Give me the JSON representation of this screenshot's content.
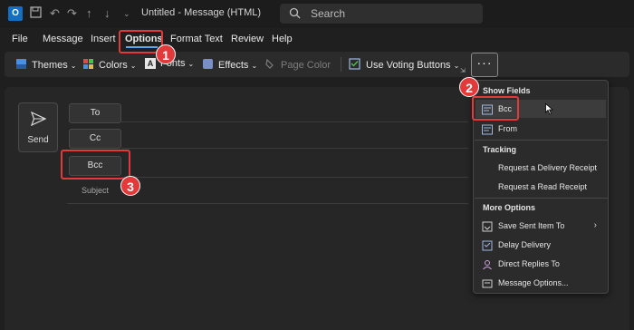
{
  "titlebar": {
    "doc_title": "Untitled  -  Message (HTML)",
    "search_placeholder": "Search"
  },
  "menu": {
    "tabs": [
      "File",
      "Message",
      "Insert",
      "Options",
      "Format Text",
      "Review",
      "Help"
    ],
    "active_tab": "Options"
  },
  "ribbon": {
    "themes": "Themes",
    "colors": "Colors",
    "fonts": "Fonts",
    "effects": "Effects",
    "page_color": "Page Color",
    "use_voting_buttons": "Use Voting Buttons",
    "more_label": "···"
  },
  "compose": {
    "send": "Send",
    "to": "To",
    "cc": "Cc",
    "bcc": "Bcc",
    "subject": "Subject"
  },
  "dropdown": {
    "show_fields_header": "Show Fields",
    "bcc": "Bcc",
    "from": "From",
    "tracking_header": "Tracking",
    "delivery_receipt": "Request a Delivery Receipt",
    "read_receipt": "Request a Read Receipt",
    "more_options_header": "More Options",
    "save_sent_item": "Save Sent Item To",
    "delay_delivery": "Delay Delivery",
    "direct_replies": "Direct Replies To",
    "message_options": "Message Options..."
  },
  "annotations": {
    "badge1": "1",
    "badge2": "2",
    "badge3": "3",
    "highlight_color": "#e23a3a"
  }
}
